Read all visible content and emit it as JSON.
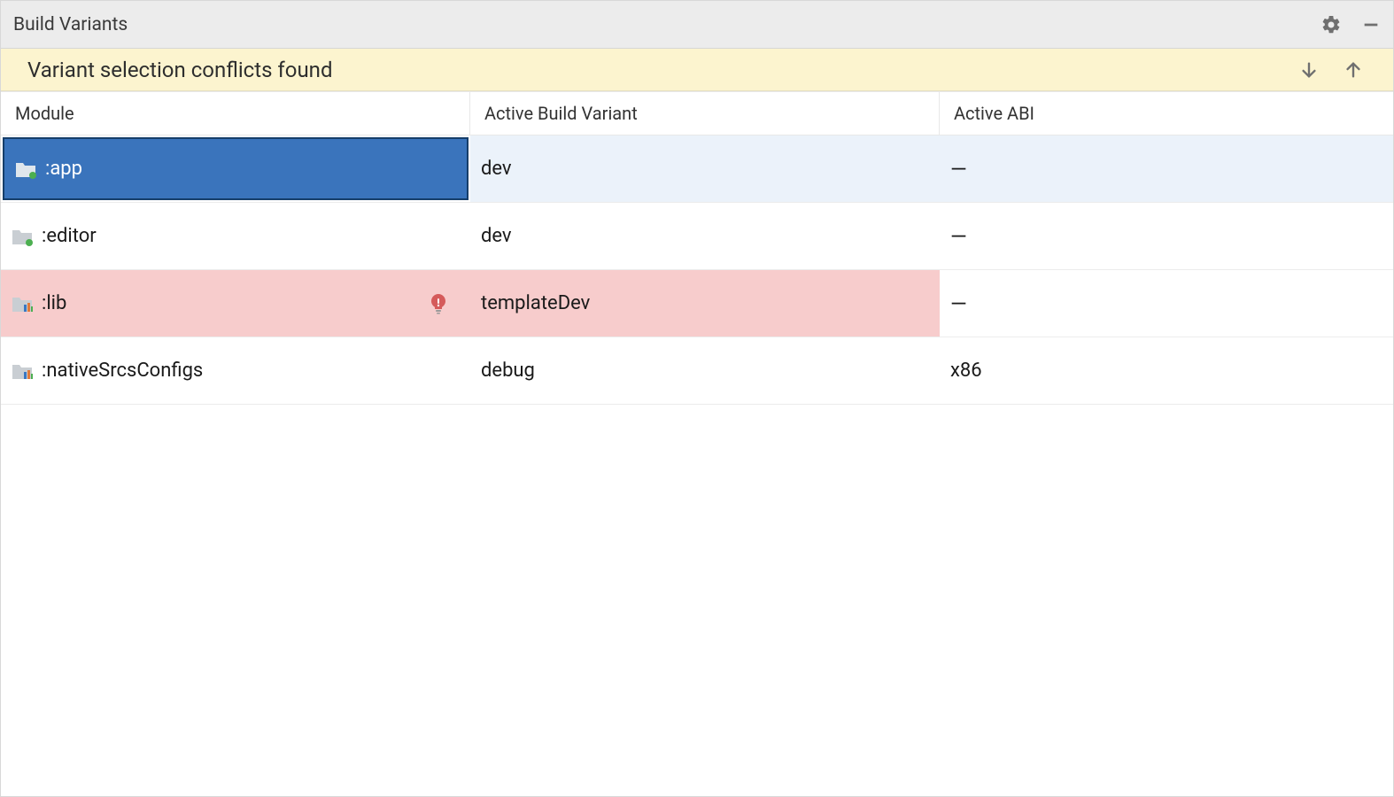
{
  "title": "Build Variants",
  "banner": {
    "message": "Variant selection conflicts found"
  },
  "columns": {
    "module": "Module",
    "variant": "Active Build Variant",
    "abi": "Active ABI"
  },
  "rows": [
    {
      "name": ":app",
      "icon": "app-folder",
      "variant": "dev",
      "abi": "—",
      "state": "selected"
    },
    {
      "name": ":editor",
      "icon": "app-folder",
      "variant": "dev",
      "abi": "—",
      "state": "normal"
    },
    {
      "name": ":lib",
      "icon": "lib-folder",
      "variant": "templateDev",
      "abi": "—",
      "state": "conflict"
    },
    {
      "name": ":nativeSrcsConfigs",
      "icon": "lib-folder",
      "variant": "debug",
      "abi": "x86",
      "state": "normal"
    }
  ],
  "colors": {
    "selectedBg": "#3a74bc",
    "selectedRowBg": "#ebf2fa",
    "conflictBg": "#f7cccc",
    "bannerBg": "#fcf4cf"
  }
}
